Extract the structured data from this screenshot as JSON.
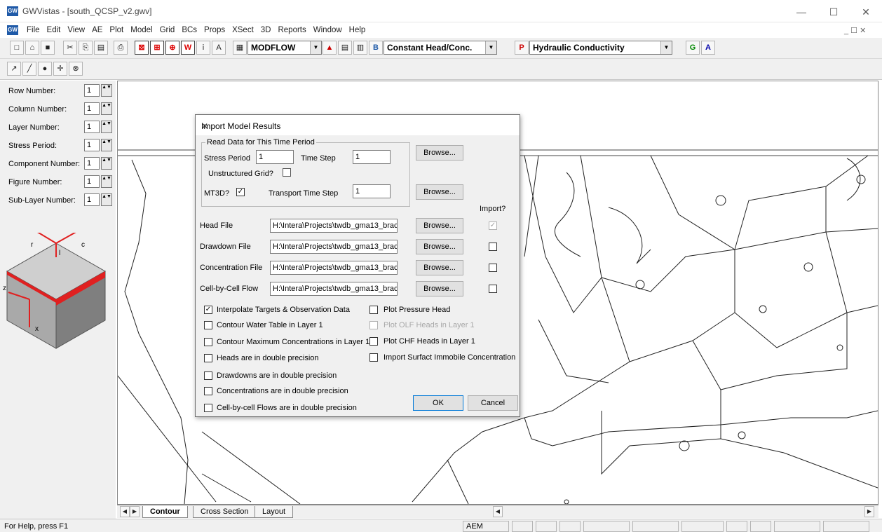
{
  "window": {
    "title": "GWVistas - [south_QCSP_v2.gwv]",
    "app_icon": "GW",
    "minimize": "—",
    "maximize": "☐",
    "close": "✕"
  },
  "menu": {
    "items": [
      "File",
      "Edit",
      "View",
      "AE",
      "Plot",
      "Model",
      "Grid",
      "BCs",
      "Props",
      "XSect",
      "3D",
      "Reports",
      "Window",
      "Help"
    ],
    "mdi_controls": "_ ☐ ✕"
  },
  "toolbar": {
    "model_combo": "MODFLOW",
    "bc_combo": "Constant Head/Conc.",
    "prop_combo": "Hydraulic Conductivity",
    "bc_icon": "B",
    "prop_icon": "P",
    "g_btn": "G",
    "a_btn": "A"
  },
  "left_panel": {
    "rows": [
      {
        "label": "Row Number:",
        "value": "1"
      },
      {
        "label": "Column Number:",
        "value": "1"
      },
      {
        "label": "Layer Number:",
        "value": "1"
      },
      {
        "label": "Stress Period:",
        "value": "1"
      },
      {
        "label": "Component Number:",
        "value": "1"
      },
      {
        "label": "Figure Number:",
        "value": "1"
      },
      {
        "label": "Sub-Layer Number:",
        "value": "1"
      }
    ],
    "cube_labels": {
      "r": "r",
      "c": "c",
      "l": "l",
      "z": "z",
      "x": "x"
    }
  },
  "dialog": {
    "title": "Import Model Results",
    "group_title": "Read Data for This Time Period",
    "stress_period_label": "Stress Period",
    "stress_period_value": "1",
    "time_step_label": "Time Step",
    "time_step_value": "1",
    "unstructured_label": "Unstructured Grid?",
    "mt3d_label": "MT3D?",
    "mt3d_checked": "✓",
    "transport_label": "Transport Time Step",
    "transport_value": "1",
    "browse": "Browse...",
    "import_header": "Import?",
    "files": [
      {
        "label": "Head File",
        "path": "H:\\Intera\\Projects\\twdb_gma13_brac",
        "checked": "✓",
        "disabled": true
      },
      {
        "label": "Drawdown File",
        "path": "H:\\Intera\\Projects\\twdb_gma13_brac",
        "checked": ""
      },
      {
        "label": "Concentration File",
        "path": "H:\\Intera\\Projects\\twdb_gma13_brac",
        "checked": ""
      },
      {
        "label": "Cell-by-Cell Flow",
        "path": "H:\\Intera\\Projects\\twdb_gma13_brac",
        "checked": ""
      }
    ],
    "options_left": [
      {
        "label": "Interpolate Targets & Observation Data",
        "checked": "✓"
      },
      {
        "label": "Contour Water Table in Layer 1",
        "checked": ""
      },
      {
        "label": "Contour Maximum Concentrations in Layer 1",
        "checked": ""
      },
      {
        "label": "Heads are in double precision",
        "checked": ""
      },
      {
        "label": "Drawdowns are in double precision",
        "checked": ""
      },
      {
        "label": "Concentrations are in double precision",
        "checked": ""
      },
      {
        "label": "Cell-by-cell Flows are in double precision",
        "checked": ""
      }
    ],
    "options_right": [
      {
        "label": "Plot Pressure Head",
        "checked": ""
      },
      {
        "label": "Plot OLF Heads in Layer 1",
        "checked": "",
        "disabled": true
      },
      {
        "label": "Plot CHF Heads in Layer 1",
        "checked": ""
      },
      {
        "label": "Import Surfact Immobile Concentration",
        "checked": ""
      }
    ],
    "ok": "OK",
    "cancel": "Cancel"
  },
  "tabs": [
    "Contour",
    "Cross Section",
    "Layout"
  ],
  "status": {
    "help": "For Help, press F1",
    "mode": "AEM"
  },
  "icons": [
    "new-icon",
    "open-icon",
    "save-icon",
    "cut-icon",
    "copy-icon",
    "paste-icon",
    "print-icon",
    "zoom-icon",
    "pan-icon",
    "info-icon",
    "select-icon",
    "line-icon",
    "circle-icon",
    "crosshair-icon",
    "delete-icon"
  ],
  "colors": {
    "cube_red": "#e02020",
    "dialog_bg": "#f0f0f0",
    "title_icon": "#1f5aa8"
  }
}
